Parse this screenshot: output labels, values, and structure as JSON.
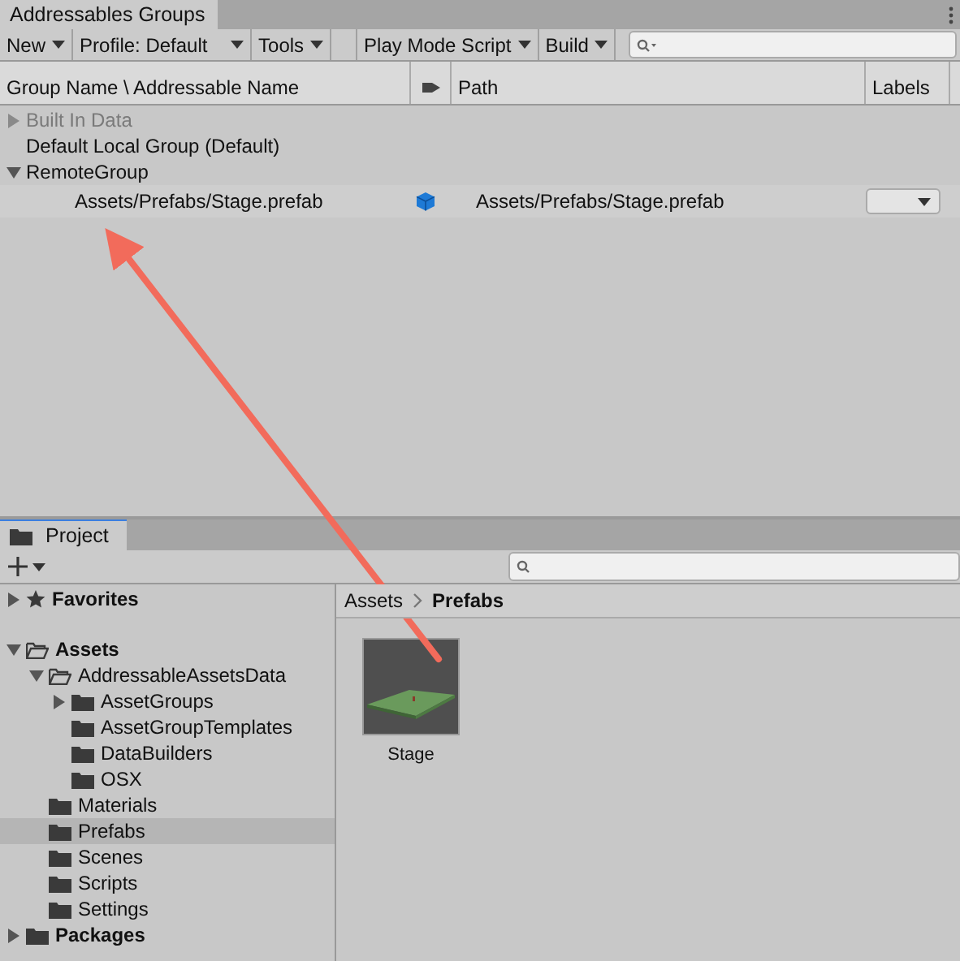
{
  "groups_window": {
    "title": "Addressables Groups",
    "toolbar": [
      {
        "label": "New",
        "kind": "dropdown"
      },
      {
        "label": "Profile: Default",
        "kind": "dropdown"
      },
      {
        "label": "Tools",
        "kind": "dropdown"
      },
      {
        "kind": "spacer"
      },
      {
        "label": "Play Mode Script",
        "kind": "dropdown"
      },
      {
        "label": "Build",
        "kind": "dropdown"
      }
    ],
    "columns": [
      "Group Name \\ Addressable Name",
      "Path",
      "Labels"
    ],
    "groups": [
      {
        "name": "Built In Data",
        "disabled": true,
        "expanded": false
      },
      {
        "name": "Default Local Group (Default)",
        "disabled": false
      },
      {
        "name": "RemoteGroup",
        "disabled": false,
        "expanded": true,
        "entries": [
          {
            "name": "Assets/Prefabs/Stage.prefab",
            "path": "Assets/Prefabs/Stage.prefab"
          }
        ]
      }
    ]
  },
  "project_window": {
    "title": "Project",
    "tree": [
      {
        "name": "Favorites",
        "kind": "star",
        "bold": true,
        "expanded": false,
        "selected": false
      },
      {
        "name": "Assets",
        "kind": "folder",
        "bold": true,
        "expanded": true,
        "selected": false,
        "children": [
          {
            "name": "AddressableAssetsData",
            "kind": "folder",
            "bold": false,
            "expanded": true,
            "selected": false,
            "children": [
              {
                "name": "AssetGroups",
                "kind": "folder",
                "bold": false,
                "expanded": false,
                "selected": false
              },
              {
                "name": "AssetGroupTemplates",
                "kind": "folder",
                "bold": false,
                "selected": false
              },
              {
                "name": "DataBuilders",
                "kind": "folder",
                "bold": false,
                "selected": false
              },
              {
                "name": "OSX",
                "kind": "folder",
                "bold": false,
                "selected": false
              }
            ]
          },
          {
            "name": "Materials",
            "kind": "folder",
            "bold": false,
            "selected": false
          },
          {
            "name": "Prefabs",
            "kind": "folder",
            "bold": false,
            "selected": true
          },
          {
            "name": "Scenes",
            "kind": "folder",
            "bold": false,
            "selected": false
          },
          {
            "name": "Scripts",
            "kind": "folder",
            "bold": false,
            "selected": false
          },
          {
            "name": "Settings",
            "kind": "folder",
            "bold": false,
            "selected": false
          }
        ]
      },
      {
        "name": "Packages",
        "kind": "folder",
        "bold": true,
        "expanded": false,
        "selected": false
      }
    ],
    "breadcrumb": [
      "Assets",
      "Prefabs"
    ],
    "assets": [
      {
        "name": "Stage",
        "kind": "picture"
      }
    ]
  }
}
